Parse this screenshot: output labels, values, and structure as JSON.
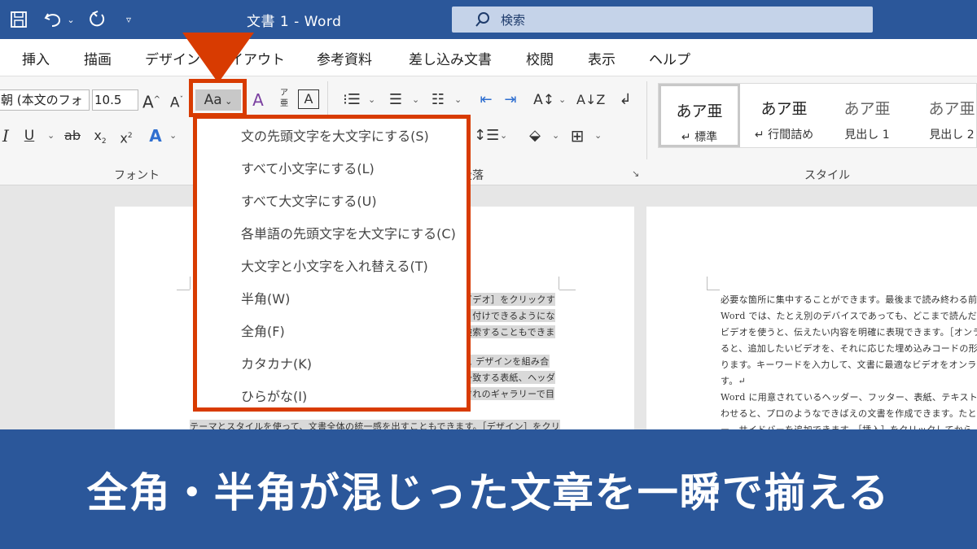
{
  "titlebar": {
    "doc_title": "文書 1  -  Word",
    "search_placeholder": "検索",
    "undo_icon": "↶",
    "redo_icon": "↻",
    "save_icon": "💾",
    "qat_icon": "⏷"
  },
  "tabs": [
    "挿入",
    "描画",
    "デザイン",
    "レイアウト",
    "参考資料",
    "差し込み文書",
    "校閲",
    "表示",
    "ヘルプ"
  ],
  "ribbon": {
    "font_name": "朝 (本文のフォ",
    "font_size": "10.5",
    "change_case_label": "Aa",
    "group_font": "フォント",
    "group_paragraph": "段落",
    "group_styles": "スタイル",
    "styles": [
      {
        "sample": "あア亜",
        "name": "↵ 標準"
      },
      {
        "sample": "あア亜",
        "name": "↵ 行間詰め"
      },
      {
        "sample": "あア亜",
        "name": "見出し 1"
      },
      {
        "sample": "あア亜",
        "name": "見出し 2"
      }
    ]
  },
  "change_case_menu": [
    "文の先頭文字を大文字にする(S)",
    "すべて小文字にする(L)",
    "すべて大文字にする(U)",
    "各単語の先頭文字を大文字にする(C)",
    "大文字と小文字を入れ替える(T)",
    "半角(W)",
    "全角(F)",
    "カタカナ(K)",
    "ひらがな(I)"
  ],
  "doc_left_lines": [
    "ビデオ］をクリックす",
    "り付けできるようにな",
    "検索することもできま",
    "ス デザインを組み合",
    "一致する表紙、ヘッダ",
    "ぞれのギャラリーで目",
    "テーマとスタイルを使って、文書全体の統一感を出すこともできます。［デザイン］をクリ"
  ],
  "doc_right_lines": [
    "必要な箇所に集中することができます。最後まで読み終わる前",
    "Word では、たとえ別のデバイスであっても、どこまで読んだ",
    "ビデオを使うと、伝えたい内容を明確に表現できます。［オンラ",
    "ると、追加したいビデオを、それに応じた埋め込みコードの形式",
    "ります。キーワードを入力して、文書に最適なビデオをオンライ",
    "す。↵",
    "Word に用意されているヘッダー、フッター、表紙、テキスト",
    "わせると、プロのようなできばえの文書を作成できます。たと",
    "ー、サイドバーを追加できます。［挿入］をクリックしてから、"
  ],
  "caption": "全角・半角が混じった文章を一瞬で揃える",
  "colors": {
    "word_blue": "#2b579a",
    "highlight_orange": "#d83b01"
  }
}
